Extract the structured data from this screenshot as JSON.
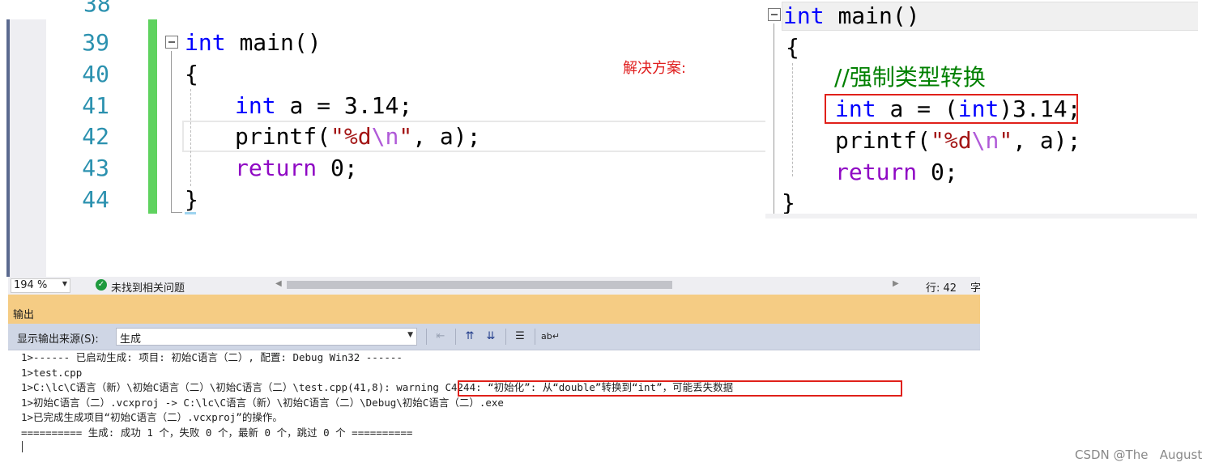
{
  "editor_left": {
    "partial_line_number": "38",
    "line_numbers": [
      "39",
      "40",
      "41",
      "42",
      "43",
      "44"
    ],
    "code": {
      "line39": {
        "type": "int",
        "fn": "main()"
      },
      "line40": "{",
      "line41": {
        "type": "int",
        "rest": "a = 3.14;"
      },
      "line42": {
        "fn": "printf(",
        "str_open": "\"%d",
        "esc": "\\n",
        "str_close": "\"",
        "rest": ", a);"
      },
      "line43": {
        "kw": "return",
        "rest": "0;"
      },
      "line44": "}"
    }
  },
  "solution_label": "解决方案:",
  "editor_right": {
    "line1": {
      "type": "int",
      "fn": "main()"
    },
    "line2": "{",
    "line3_comment": "//强制类型转换",
    "line4": {
      "type": "int",
      "mid": "a = (",
      "cast": "int",
      "rest": ")3.14;"
    },
    "line5": {
      "fn": "printf(",
      "str_open": "\"%d",
      "esc": "\\n",
      "str_close": "\"",
      "rest": ", a);"
    },
    "line6": {
      "kw": "return",
      "rest": "0;"
    },
    "line7": "}"
  },
  "status_bar": {
    "zoom": "194 %",
    "issues": "未找到相关问题",
    "line": "行: 42",
    "col_partial": "字"
  },
  "output": {
    "title": "输出",
    "source_label": "显示输出来源(S):",
    "source_value": "生成",
    "lines": [
      "1>------ 已启动生成: 项目: 初始C语言（二）, 配置: Debug Win32 ------",
      "1>test.cpp",
      "1>C:\\lc\\C语言（新）\\初始C语言（二）\\初始C语言（二）\\test.cpp(41,8): warning C4244: “初始化”: 从“double”转换到“int”，可能丢失数据",
      "1>初始C语言（二）.vcxproj -> C:\\lc\\C语言（新）\\初始C语言（二）\\Debug\\初始C语言（二）.exe",
      "1>已完成生成项目“初始C语言（二）.vcxproj”的操作。",
      "========== 生成: 成功 1 个，失败 0 个，最新 0 个，跳过 0 个 =========="
    ]
  },
  "watermark": "CSDN @The   August"
}
